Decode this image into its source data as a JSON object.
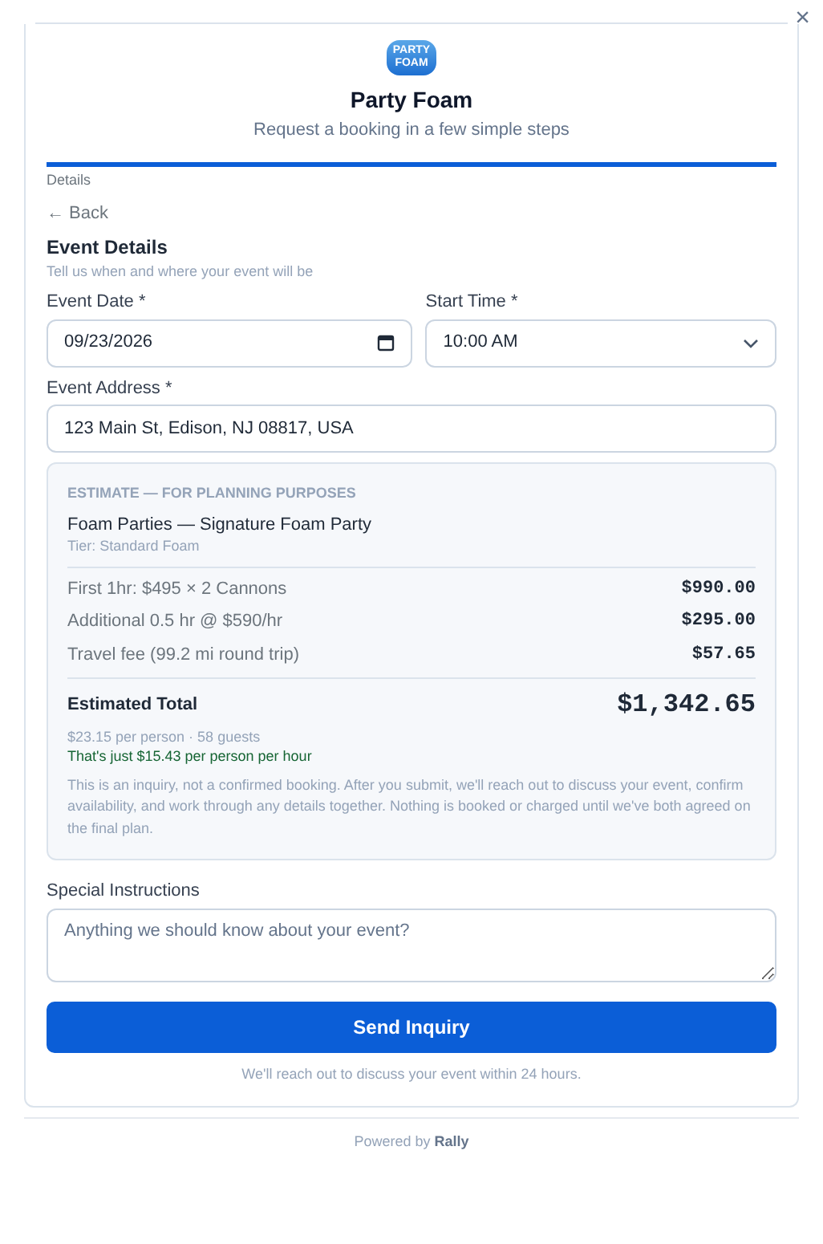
{
  "close_label": "×",
  "header": {
    "logo_text": [
      "PARTY",
      "FOAM"
    ],
    "title": "Party Foam",
    "subtitle": "Request a booking in a few simple steps"
  },
  "progress": {
    "level": 1.0,
    "step_label": "Details"
  },
  "back_link": "← Back",
  "section": {
    "title": "Event Details",
    "subtitle": "Tell us when and where your event will be"
  },
  "fields": [
    {
      "label": "Event Date *",
      "kind": "date",
      "value": "09/23/2026"
    },
    {
      "label": "Start Time *",
      "kind": "select",
      "value": "10:00 AM"
    },
    {
      "label": "Event Address *",
      "kind": "text",
      "value": "123 Main St, Edison, NJ 08817, USA"
    }
  ],
  "estimate": {
    "heading": "ESTIMATE — FOR PLANNING PURPOSES",
    "package": "Foam Parties — Signature Foam Party",
    "tier": "Tier: Standard Foam",
    "lines": [
      {
        "label": "First 1hr: $495 × 2 Cannons",
        "amount": "$990.00"
      },
      {
        "label": "Additional 0.5 hr @ $590/hr",
        "amount": "$295.00"
      },
      {
        "label": "Travel fee (99.2 mi round trip)",
        "amount": "$57.65"
      }
    ],
    "total_label": "Estimated Total",
    "total": "$1,342.65",
    "per_person": "$23.15 per person · 58 guests",
    "per_hour": "That's just $15.43 per person per hour",
    "disclaimer": "This is an inquiry, not a confirmed booking. After you submit, we'll reach out to discuss your event, confirm availability, and work through any details together. Nothing is booked or charged until we've both agreed on the final plan."
  },
  "instructions": {
    "label": "Special Instructions",
    "placeholder": "Anything we should know about your event?"
  },
  "submit": "Send Inquiry",
  "note": "We'll reach out to discuss your event within 24 hours.",
  "footer": {
    "prefix": "Powered by",
    "brand": "Rally"
  }
}
